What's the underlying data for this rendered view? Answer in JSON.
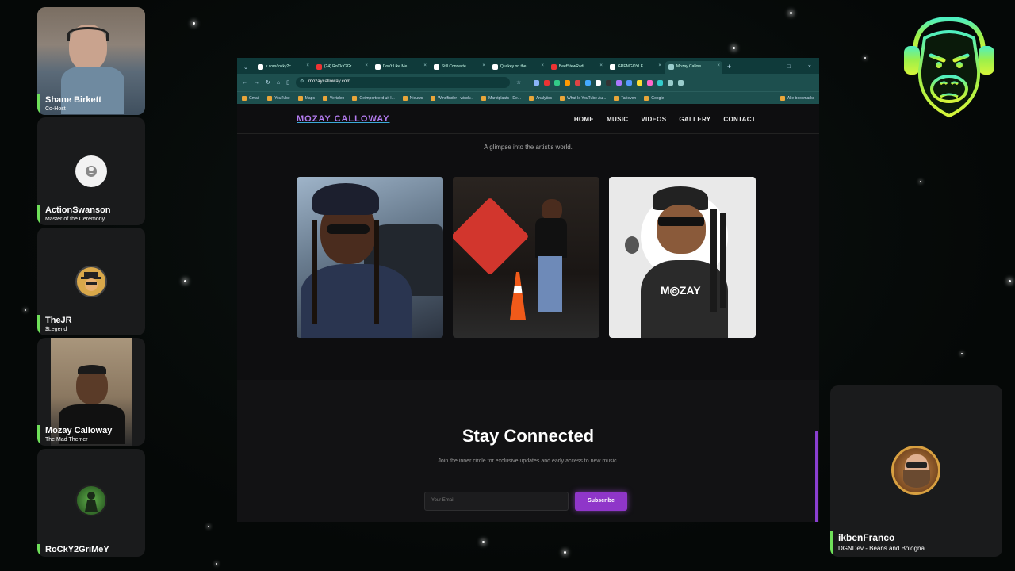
{
  "participants": [
    {
      "name": "Shane Birkett",
      "role": "Co-Host"
    },
    {
      "name": "ActionSwanson",
      "role": "Master of the Ceremony"
    },
    {
      "name": "TheJR",
      "role": "$Legend"
    },
    {
      "name": "Mozay Calloway",
      "role": "The Mad Themer"
    },
    {
      "name": "RoCkY2GriMeY",
      "role": ""
    }
  ],
  "featured_participant": {
    "name": "ikbenFranco",
    "role": "DGNDev - Beans and Bologna"
  },
  "browser": {
    "tabs": [
      {
        "label": "x.com/rocky2c",
        "color": "#fff"
      },
      {
        "label": "(24) RoCkY2Gr",
        "color": "#e33"
      },
      {
        "label": "Don't Like Me",
        "color": "#fff"
      },
      {
        "label": "Still Connecte",
        "color": "#fff"
      },
      {
        "label": "Quakey on the",
        "color": "#fff"
      },
      {
        "label": "BeefStewRadi",
        "color": "#e33"
      },
      {
        "label": "GREMGOYLE",
        "color": "#fff"
      },
      {
        "label": "Mozay Callow",
        "color": "#9cc"
      }
    ],
    "url": "mozaycalloway.com",
    "bookmarks": [
      "Gmail",
      "YouTube",
      "Maps",
      "Vertalen",
      "Geïmporteerd uit I...",
      "Nieuws",
      "Windfinder - windv...",
      "Marktplaats - De...",
      "Analytics",
      "What Is YouTube Au...",
      "Tarieven",
      "Google"
    ],
    "all_bookmarks": "Alle bookmarks"
  },
  "site": {
    "brand": "MOZAY CALLOWAY",
    "menu": [
      "HOME",
      "MUSIC",
      "VIDEOS",
      "GALLERY",
      "CONTACT"
    ],
    "gallery_subtitle": "A glimpse into the artist's world.",
    "connect_title": "Stay Connected",
    "connect_subtitle": "Join the inner circle for exclusive updates and early access to new music.",
    "email_placeholder": "Your Email",
    "subscribe_label": "Subscribe"
  },
  "colors": {
    "accent_purple": "#8f36c9",
    "speaker_green": "#6fe05a",
    "browser_teal": "#1d4f4e"
  }
}
